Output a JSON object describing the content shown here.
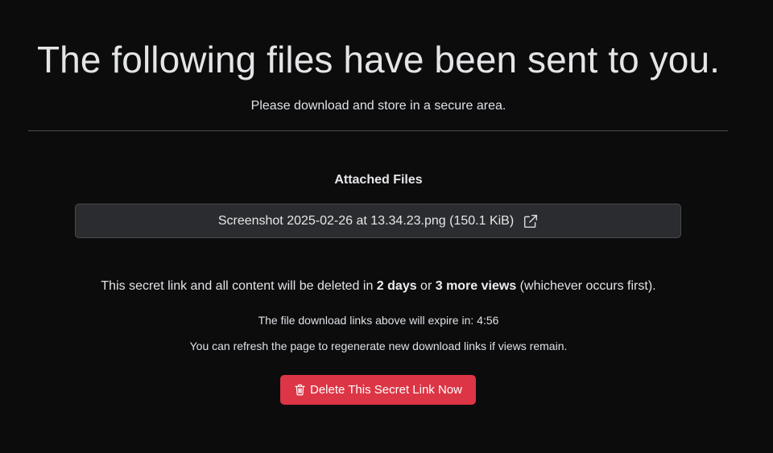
{
  "header": {
    "title": "The following files have been sent to you.",
    "subtitle": "Please download and store in a secure area."
  },
  "attachments": {
    "section_title": "Attached Files",
    "files": [
      {
        "label": "Screenshot 2025-02-26 at 13.34.23.png (150.1 KiB)",
        "icon": "external-link-icon"
      }
    ]
  },
  "expiry": {
    "prefix": "This secret link and all content will be deleted in ",
    "days": "2 days",
    "connector": " or ",
    "views": "3 more views",
    "suffix": " (whichever occurs first)."
  },
  "download_timer": {
    "text": "The file download links above will expire in: 4:56"
  },
  "refresh_note": {
    "text": "You can refresh the page to regenerate new download links if views remain."
  },
  "actions": {
    "delete_label": "Delete This Secret Link Now",
    "delete_icon": "trash-icon"
  },
  "colors": {
    "background": "#0c0c0d",
    "file_item_background": "#2b2c2f",
    "danger": "#dc3545",
    "text": "#dee2e6"
  }
}
